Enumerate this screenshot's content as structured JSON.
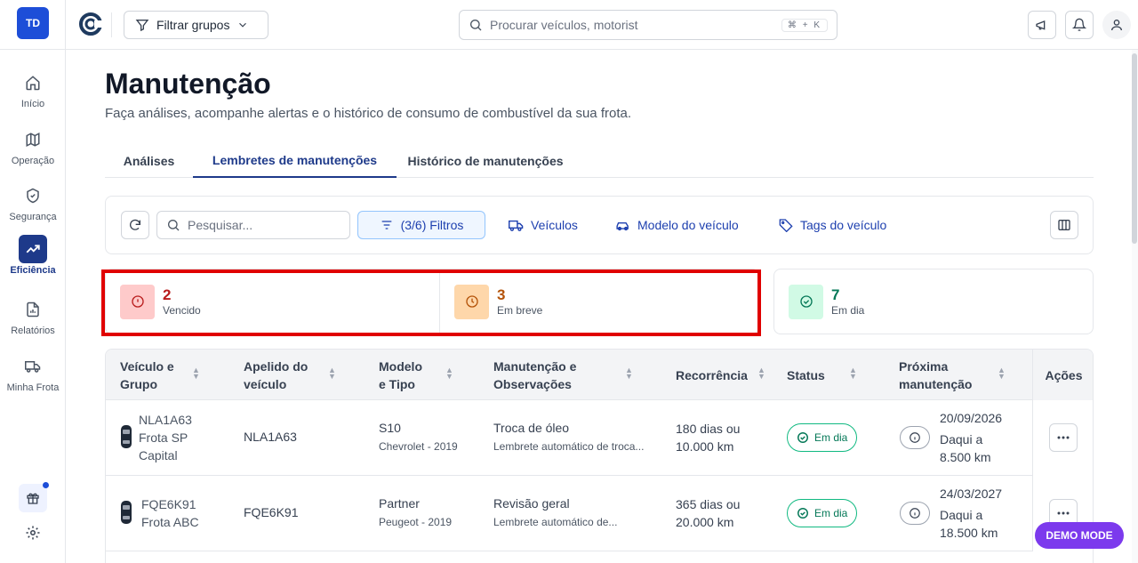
{
  "sidebar": {
    "avatar": "TD",
    "items": [
      {
        "label": "Início",
        "icon": "home-icon"
      },
      {
        "label": "Operação",
        "icon": "map-icon"
      },
      {
        "label": "Segurança",
        "icon": "shield-icon"
      },
      {
        "label": "Eficiência",
        "icon": "trending-up-icon",
        "active": true
      },
      {
        "label": "Relatórios",
        "icon": "report-icon"
      },
      {
        "label": "Minha Frota",
        "icon": "truck-icon"
      }
    ]
  },
  "topbar": {
    "group_filter": "Filtrar grupos",
    "search_placeholder": "Procurar veículos, motorist",
    "shortcut": "⌘ + K"
  },
  "page": {
    "title": "Manutenção",
    "subtitle": "Faça análises, acompanhe alertas e o histórico de consumo de combustível da sua frota."
  },
  "tabs": [
    {
      "label": "Análises"
    },
    {
      "label": "Lembretes de manutenções",
      "active": true
    },
    {
      "label": "Histórico de manutenções"
    }
  ],
  "toolbar": {
    "search_placeholder": "Pesquisar...",
    "filters_label": "(3/6) Filtros",
    "vehicles_label": "Veículos",
    "model_label": "Modelo do veículo",
    "tags_label": "Tags do veículo"
  },
  "stats": {
    "overdue": {
      "count": "2",
      "label": "Vencido",
      "color": "#b91c1c"
    },
    "soon": {
      "count": "3",
      "label": "Em breve",
      "color": "#b45309"
    },
    "ok": {
      "count": "7",
      "label": "Em dia",
      "color": "#047857"
    }
  },
  "table": {
    "headers": {
      "vehicle": [
        "Veículo e",
        "Grupo"
      ],
      "nickname": [
        "Apelido do",
        "veículo"
      ],
      "model": [
        "Modelo",
        "e Tipo"
      ],
      "maintenance": [
        "Manutenção e",
        "Observações"
      ],
      "recurrence": "Recorrência",
      "status": "Status",
      "next": [
        "Próxima",
        "manutenção"
      ],
      "actions": "Ações"
    },
    "rows": [
      {
        "vehicle_lines": [
          "NLA1A63",
          "Frota SP",
          "Capital"
        ],
        "nickname": "NLA1A63",
        "model": "S10",
        "type": "Chevrolet - 2019",
        "maintenance": "Troca de óleo",
        "notes": "Lembrete automático de troca...",
        "recurrence": [
          "180 dias ou",
          "10.000 km"
        ],
        "status": "Em dia",
        "next_date": "20/09/2026",
        "next_in": [
          "Daqui a",
          "8.500 km"
        ]
      },
      {
        "vehicle_lines": [
          "FQE6K91",
          "Frota ABC"
        ],
        "nickname": "FQE6K91",
        "model": "Partner",
        "type": "Peugeot - 2019",
        "maintenance": "Revisão geral",
        "notes": "Lembrete automático de...",
        "recurrence": [
          "365 dias ou",
          "20.000 km"
        ],
        "status": "Em dia",
        "next_date": "24/03/2027",
        "next_in": [
          "Daqui a",
          "18.500 km"
        ]
      }
    ]
  },
  "demo_mode": "DEMO MODE"
}
